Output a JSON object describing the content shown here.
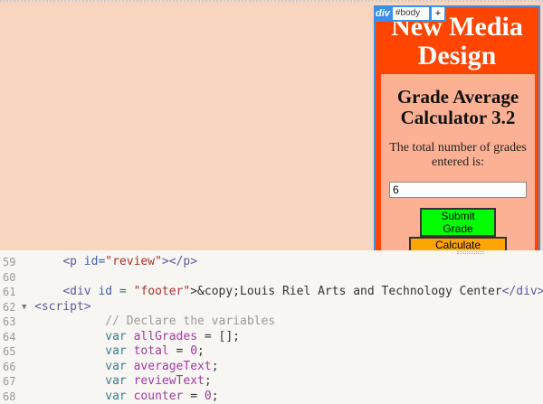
{
  "preview": {
    "badge": {
      "tag": "div",
      "selector": "#body",
      "add": "+"
    },
    "site_title": "New Media Design",
    "heading": "Grade Average Calculator 3.2",
    "count_label": "The total number of grades entered is:",
    "count_value": "6",
    "submit_button": "Submit Grade",
    "calculate_button": "Calculate Average"
  },
  "code": [
    {
      "n": "59",
      "t": [
        [
          "    ",
          "plain"
        ],
        [
          "<p ",
          "tag"
        ],
        [
          "id=",
          "attr"
        ],
        [
          "\"review\"",
          "str"
        ],
        [
          "></p>",
          "tag"
        ]
      ]
    },
    {
      "n": "60",
      "t": []
    },
    {
      "n": "61",
      "t": [
        [
          "    ",
          "plain"
        ],
        [
          "<div ",
          "tag"
        ],
        [
          "id = ",
          "attr"
        ],
        [
          "\"footer\"",
          "str"
        ],
        [
          ">&copy;Louis Riel Arts and Technology Center",
          "plain"
        ],
        [
          "</div>",
          "tag"
        ]
      ]
    },
    {
      "n": "62",
      "fold": "▼",
      "t": [
        [
          "<script>",
          "tag"
        ]
      ]
    },
    {
      "n": "63",
      "t": [
        [
          "          ",
          "plain"
        ],
        [
          "// Declare the variables",
          "cm"
        ]
      ]
    },
    {
      "n": "64",
      "t": [
        [
          "          ",
          "plain"
        ],
        [
          "var ",
          "kw"
        ],
        [
          "allGrades",
          "id"
        ],
        [
          " = [];",
          "plain"
        ]
      ]
    },
    {
      "n": "65",
      "t": [
        [
          "          ",
          "plain"
        ],
        [
          "var ",
          "kw"
        ],
        [
          "total",
          "id"
        ],
        [
          " = ",
          "plain"
        ],
        [
          "0",
          "num"
        ],
        [
          ";",
          "plain"
        ]
      ]
    },
    {
      "n": "66",
      "t": [
        [
          "          ",
          "plain"
        ],
        [
          "var ",
          "kw"
        ],
        [
          "averageText",
          "id"
        ],
        [
          ";",
          "plain"
        ]
      ]
    },
    {
      "n": "67",
      "t": [
        [
          "          ",
          "plain"
        ],
        [
          "var ",
          "kw"
        ],
        [
          "reviewText",
          "id"
        ],
        [
          ";",
          "plain"
        ]
      ]
    },
    {
      "n": "68",
      "t": [
        [
          "          ",
          "plain"
        ],
        [
          "var ",
          "kw"
        ],
        [
          "counter",
          "id"
        ],
        [
          " = ",
          "plain"
        ],
        [
          "0",
          "num"
        ],
        [
          ";",
          "plain"
        ]
      ]
    }
  ]
}
